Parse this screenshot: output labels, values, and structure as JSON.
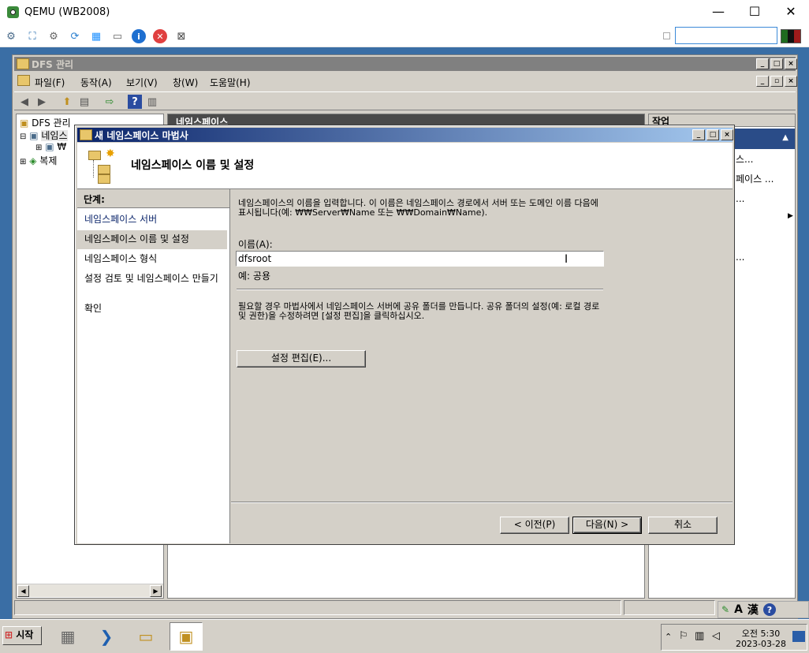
{
  "qemu": {
    "title": "QEMU (WB2008)",
    "min": "—",
    "max": "☐",
    "close": "✕",
    "search_placeholder": ""
  },
  "mmc": {
    "title": "DFS 관리",
    "menu": [
      "파일(F)",
      "동작(A)",
      "보기(V)",
      "창(W)",
      "도움말(H)"
    ],
    "tree": {
      "root": "DFS 관리",
      "namespace": "네임스",
      "child": "₩",
      "replication": "복제"
    },
    "center_header": "네임스페이스",
    "actions_header": "작업",
    "actions": [
      "스...",
      "페이스 ...",
      "...",
      "...",
      "..."
    ]
  },
  "wizard": {
    "title": "새 네임스페이스 마법사",
    "heading": "네임스페이스 이름 및 설정",
    "steps_header": "단계:",
    "steps": [
      "네임스페이스 서버",
      "네임스페이스 이름 및 설정",
      "네임스페이스 형식",
      "설정 검토 및 네임스페이스 만들기",
      "확인"
    ],
    "intro": "네임스페이스의 이름을 입력합니다. 이 이름은 네임스페이스 경로에서 서버 또는 도메인 이름 다음에 표시됩니다(예: ₩₩Server₩Name 또는 ₩₩Domain₩Name).",
    "name_label": "이름(A):",
    "name_value": "dfsroot",
    "example": "예: 공용",
    "note": "필요할 경우 마법사에서 네임스페이스 서버에 공유 폴더를 만듭니다. 공유 폴더의 설정(예: 로컬 경로 및 권한)을 수정하려면 [설정 편집]을 클릭하십시오.",
    "edit_button": "설정 편집(E)...",
    "prev_button": "< 이전(P)",
    "next_button": "다음(N) >",
    "cancel_button": "취소"
  },
  "taskbar": {
    "start": "시작",
    "clock_time": "오전 5:30",
    "clock_date": "2023-03-28",
    "ime_a": "A",
    "ime_han": "漢"
  },
  "colors": {
    "desktop": "#3a6ea5",
    "wizard_title_start": "#0a246a",
    "wizard_title_end": "#a6caf0"
  }
}
